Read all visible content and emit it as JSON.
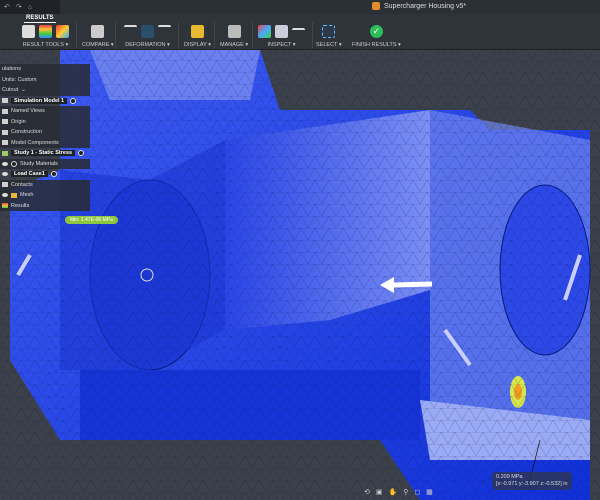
{
  "app": {
    "document_title": "Supercharger Housing v5*",
    "quick_access": [
      "undo",
      "redo",
      "home"
    ]
  },
  "ribbon": {
    "active_tab": "RESULTS",
    "groups": [
      {
        "label": "RESULT TOOLS ▾"
      },
      {
        "label": "COMPARE ▾"
      },
      {
        "label": "DEFORMATION ▾"
      },
      {
        "label": "DISPLAY ▾"
      },
      {
        "label": "MANAGE ▾"
      },
      {
        "label": "INSPECT ▾"
      },
      {
        "label": "SELECT ▾"
      },
      {
        "label": "FINISH RESULTS ▾"
      }
    ]
  },
  "browser": {
    "items": [
      {
        "label": "ulations"
      },
      {
        "label": "Units: Custom"
      },
      {
        "label": "Cutout"
      },
      {
        "label": "Simulation Model 1"
      },
      {
        "label": "Named Views"
      },
      {
        "label": "Origin"
      },
      {
        "label": "Construction"
      },
      {
        "label": "Model Components"
      },
      {
        "label": "Study 1 - Static Stress"
      },
      {
        "label": "Study Materials"
      },
      {
        "label": "Load Case1"
      },
      {
        "label": "Contacts"
      },
      {
        "label": "Mesh"
      },
      {
        "label": "Results"
      }
    ]
  },
  "viewport": {
    "min_label": "Min: 1.47E-06 MPa",
    "probe_value": "0.209 MPa",
    "probe_coords": "[x:-0.971 y:-3.907 z:-0.532] in"
  },
  "colors": {
    "accent": "#8ec63f",
    "mesh_blue": "#1f3de0",
    "finish": "#2ebd59"
  }
}
